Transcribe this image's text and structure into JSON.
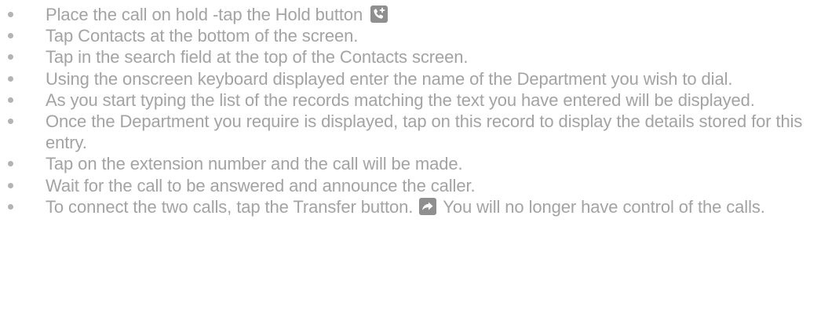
{
  "colors": {
    "text": "#a3a3a3",
    "bullet": "#b3b3b3",
    "icon_background": "#8f8f8f"
  },
  "icons": {
    "hold": "phone-plus-icon",
    "transfer": "forward-arrow-icon"
  },
  "steps": [
    {
      "text": "Place the call on hold -tap the Hold button"
    },
    {
      "text": "Tap Contacts at the bottom of the screen."
    },
    {
      "text": "Tap in the search field at the top of the Contacts screen."
    },
    {
      "text": "Using the onscreen keyboard displayed enter the name of the Department you wish to dial."
    },
    {
      "text": "As you start typing the list of the records matching the text you have entered will be displayed."
    },
    {
      "text": "Once the Department you require is displayed, tap on this record to display the details stored for this entry."
    },
    {
      "text": "Tap on the extension number and the call will be made."
    },
    {
      "text": "Wait for the call to be answered and announce the caller."
    },
    {
      "text_before": "To connect the two calls, tap the Transfer button.",
      "text_after": "You will no longer have control of the calls."
    }
  ]
}
